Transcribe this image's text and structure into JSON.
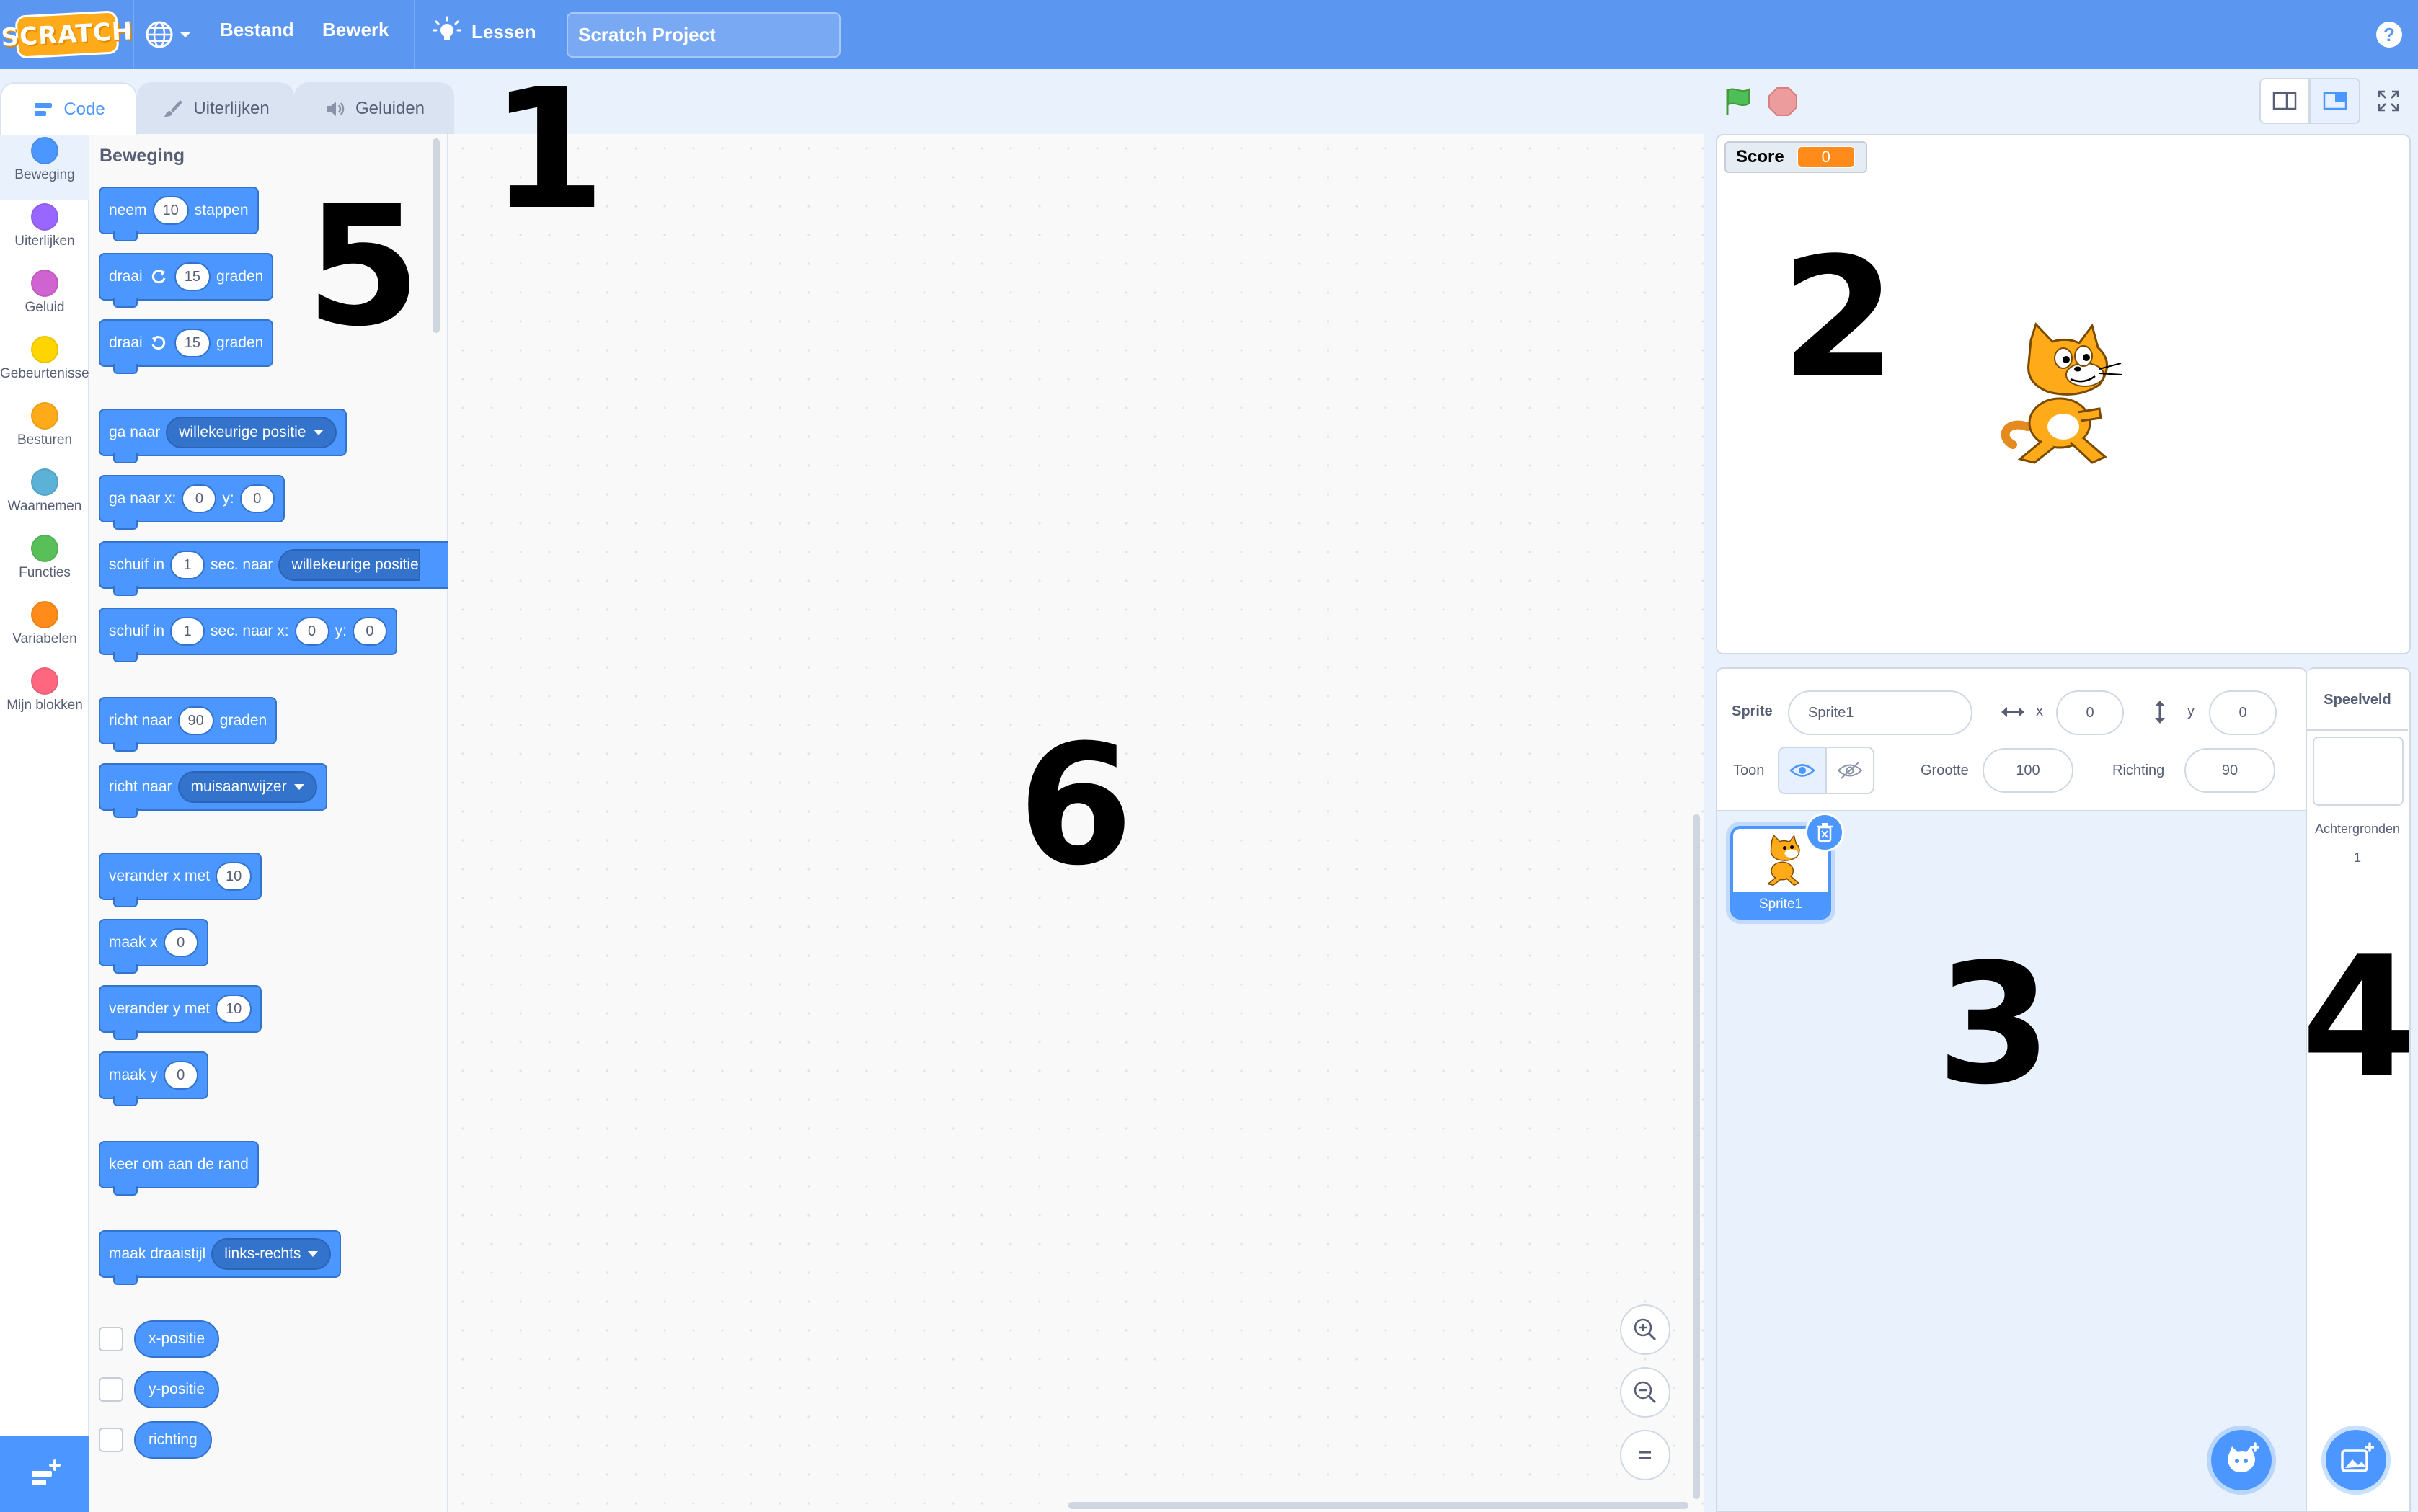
{
  "menubar": {
    "logo": "SCRATCH",
    "globe_icon": "globe-icon",
    "file": "Bestand",
    "edit": "Bewerk",
    "lessons": "Lessen",
    "project_title": "Scratch Project",
    "help": "?"
  },
  "tabs": [
    {
      "label": "Code",
      "icon": "code-icon"
    },
    {
      "label": "Uiterlijken",
      "icon": "brush-icon"
    },
    {
      "label": "Geluiden",
      "icon": "speaker-icon"
    }
  ],
  "categories": [
    {
      "label": "Beweging",
      "color": "#4c97ff"
    },
    {
      "label": "Uiterlijken",
      "color": "#9966ff"
    },
    {
      "label": "Geluid",
      "color": "#cf63cf"
    },
    {
      "label": "Gebeurtenissen",
      "color": "#ffd500"
    },
    {
      "label": "Besturen",
      "color": "#ffab19"
    },
    {
      "label": "Waarnemen",
      "color": "#5cb1d6"
    },
    {
      "label": "Functies",
      "color": "#59c059"
    },
    {
      "label": "Variabelen",
      "color": "#ff8c1a"
    },
    {
      "label": "Mijn blokken",
      "color": "#ff6680"
    }
  ],
  "palette": {
    "title": "Beweging",
    "blocks": {
      "move": {
        "t1": "neem",
        "v1": "10",
        "t2": "stappen"
      },
      "turn_right": {
        "t1": "draai",
        "v1": "15",
        "t2": "graden"
      },
      "turn_left": {
        "t1": "draai",
        "v1": "15",
        "t2": "graden"
      },
      "goto": {
        "t1": "ga naar",
        "d1": "willekeurige positie"
      },
      "goto_xy": {
        "t1": "ga naar x:",
        "v1": "0",
        "t2": "y:",
        "v2": "0"
      },
      "glide_to": {
        "t1": "schuif in",
        "v1": "1",
        "t2": "sec. naar",
        "d1": "willekeurige positie"
      },
      "glide_xy": {
        "t1": "schuif in",
        "v1": "1",
        "t2": "sec. naar x:",
        "v2": "0",
        "t3": "y:",
        "v3": "0"
      },
      "point_dir": {
        "t1": "richt naar",
        "v1": "90",
        "t2": "graden"
      },
      "point_towards": {
        "t1": "richt naar",
        "d1": "muisaanwijzer"
      },
      "change_x": {
        "t1": "verander x met",
        "v1": "10"
      },
      "set_x": {
        "t1": "maak x",
        "v1": "0"
      },
      "change_y": {
        "t1": "verander y met",
        "v1": "10"
      },
      "set_y": {
        "t1": "maak y",
        "v1": "0"
      },
      "bounce": {
        "t1": "keer om aan de rand"
      },
      "rotation_style": {
        "t1": "maak draaistijl",
        "d1": "links-rechts"
      }
    },
    "reporters": [
      "x-positie",
      "y-positie",
      "richting"
    ]
  },
  "stage": {
    "monitor_label": "Score",
    "monitor_value": "0"
  },
  "sprite_info": {
    "sprite_label": "Sprite",
    "sprite_name": "Sprite1",
    "x_label": "x",
    "x_value": "0",
    "y_label": "y",
    "y_value": "0",
    "show_label": "Toon",
    "size_label": "Grootte",
    "size_value": "100",
    "direction_label": "Richting",
    "direction_value": "90"
  },
  "sprites": [
    {
      "name": "Sprite1"
    }
  ],
  "stage_pane": {
    "title": "Speelveld",
    "backdrops_label": "Achtergronden",
    "backdrops_count": "1"
  },
  "annotations": [
    "1",
    "2",
    "3",
    "4",
    "5",
    "6"
  ]
}
